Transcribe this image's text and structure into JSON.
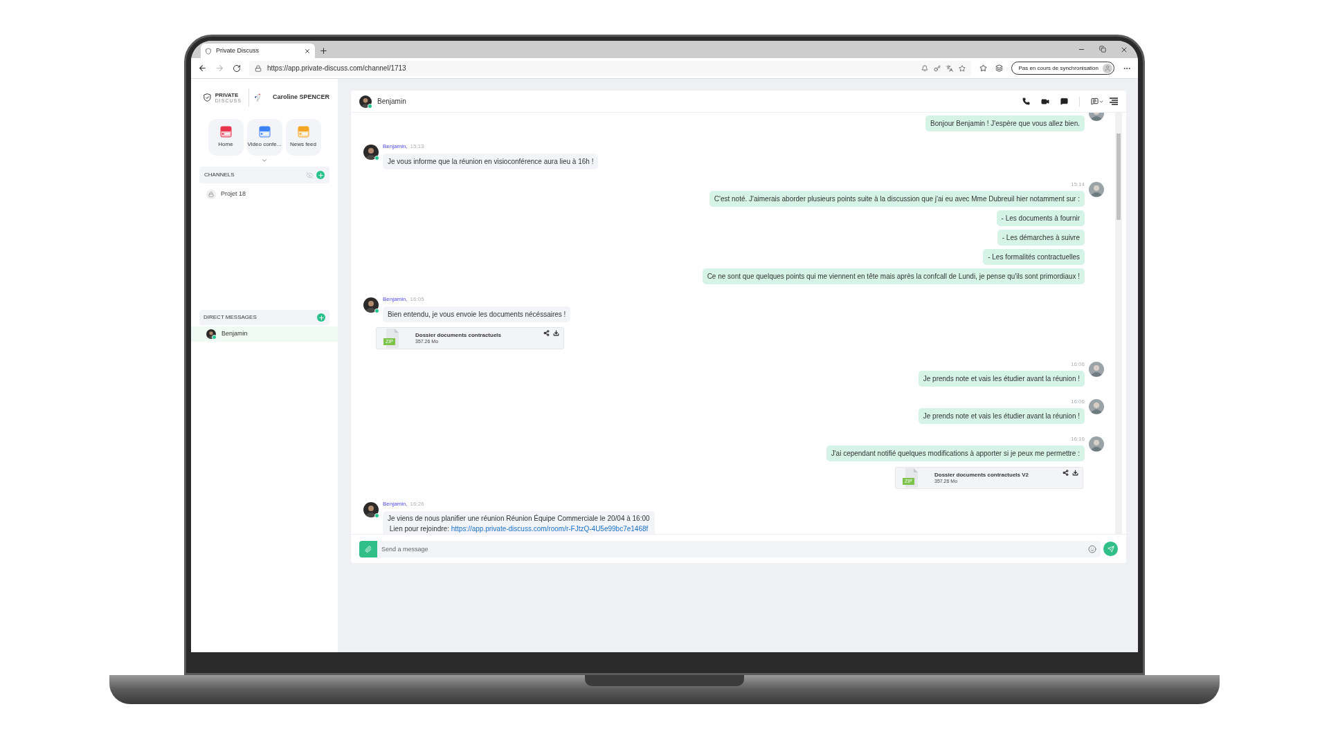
{
  "browser": {
    "tab_title": "Private Discuss",
    "url": "https://app.private-discuss.com/channel/1713",
    "sync_button": "Pas en cours de synchronisation"
  },
  "sidebar": {
    "brand": {
      "line1": "PRIVATE",
      "line2": "DISCUSS"
    },
    "user": "Caroline SPENCER",
    "tiles": [
      {
        "kind": "home",
        "label": "Home"
      },
      {
        "kind": "video",
        "label": "Video confe..."
      },
      {
        "kind": "news",
        "label": "News feed"
      }
    ],
    "channels": {
      "title": "CHANNELS",
      "items": [
        {
          "label": "Projet 18",
          "selected": false
        }
      ]
    },
    "direct_messages": {
      "title": "DIRECT MESSAGES",
      "items": [
        {
          "label": "Benjamin",
          "selected": true,
          "online": true
        }
      ]
    }
  },
  "chat": {
    "contact": "Benjamin",
    "online": true,
    "groups": [
      {
        "kind": "outgoing",
        "items": [
          {
            "kind": "text",
            "text": "Bonjour Benjamin ! J'espère que vous allez bien."
          }
        ]
      },
      {
        "kind": "incoming",
        "author": "Benjamin,",
        "time": "15:13",
        "online": true,
        "items": [
          {
            "kind": "text",
            "text": "Je vous informe que la réunion en visioconférence aura lieu à 16h !"
          }
        ]
      },
      {
        "kind": "outgoing",
        "time": "15:14",
        "items": [
          {
            "kind": "text",
            "text": "C'est noté. J'aimerais aborder plusieurs points suite à la discussion que j'ai eu avec Mme Dubreuil hier notamment sur :"
          },
          {
            "kind": "text",
            "text": "- Les documents à fournir"
          },
          {
            "kind": "text",
            "text": "- Les démarches à suivre"
          },
          {
            "kind": "text",
            "text": "- Les formalités contractuelles"
          },
          {
            "kind": "text",
            "text": "Ce ne sont que quelques points qui me viennent en tête mais après la confcall de Lundi, je pense qu'ils sont primordiaux !"
          }
        ]
      },
      {
        "kind": "incoming",
        "author": "Benjamin,",
        "time": "16:05",
        "online": true,
        "items": [
          {
            "kind": "text",
            "text": "Bien entendu, je vous envoie les documents nécéssaires !"
          },
          {
            "kind": "file",
            "name": "Dossier documents contractuels",
            "size": "357.26 Mo",
            "badge": "ZIP"
          }
        ]
      },
      {
        "kind": "outgoing",
        "time": "16:06",
        "items": [
          {
            "kind": "text",
            "text": "Je prends note et vais les étudier avant la réunion !"
          }
        ]
      },
      {
        "kind": "outgoing",
        "time": "16:06",
        "items": [
          {
            "kind": "text",
            "text": "Je prends note et vais les étudier avant la réunion !"
          }
        ]
      },
      {
        "kind": "outgoing",
        "time": "16:16",
        "items": [
          {
            "kind": "text",
            "text": "J'ai cependant notifié quelques modifications à apporter si je peux me permettre :"
          },
          {
            "kind": "file",
            "name": "Dossier documents contractuels V2",
            "size": "357.26 Mo",
            "badge": "ZIP"
          }
        ]
      },
      {
        "kind": "incoming",
        "author": "Benjamin,",
        "time": "16:26",
        "online": true,
        "items": [
          {
            "kind": "invite",
            "text": "Je viens de nous planifier une réunion Réunion Équipe Commerciale le 20/04 à 16:00",
            "link_label": "Lien pour rejoindre:",
            "link": "https://app.private-discuss.com/room/r-FJtzQ-4U5e99bc7e1468f"
          }
        ]
      }
    ],
    "composer": {
      "placeholder": "Send a message"
    }
  }
}
